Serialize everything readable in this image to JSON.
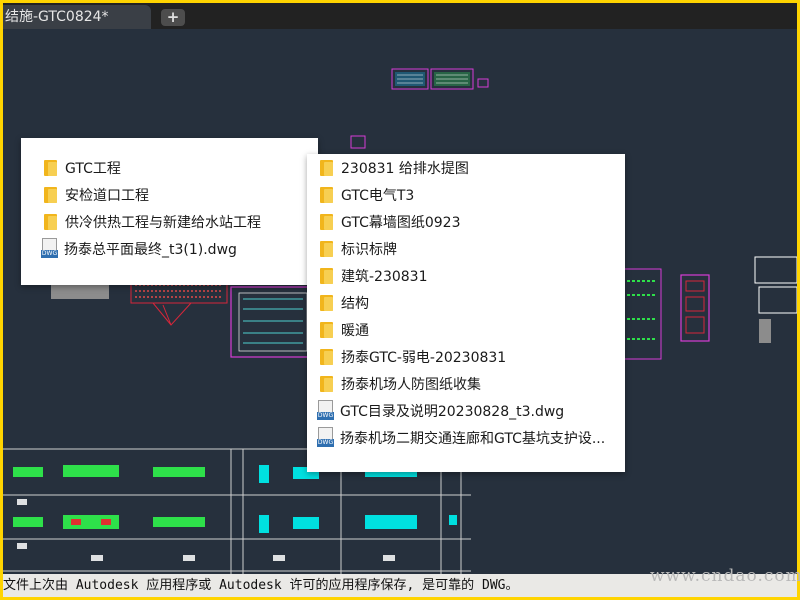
{
  "document_tab": {
    "title": "结施-GTC0824*"
  },
  "new_tab_button": {
    "label": "+"
  },
  "menu_left": {
    "items": [
      {
        "type": "folder",
        "label": "GTC工程"
      },
      {
        "type": "folder",
        "label": "安检道口工程"
      },
      {
        "type": "folder",
        "label": "供冷供热工程与新建给水站工程"
      },
      {
        "type": "dwg",
        "label": "扬泰总平面最终_t3(1).dwg"
      }
    ]
  },
  "menu_right": {
    "items": [
      {
        "type": "folder",
        "label": "230831 给排水提图"
      },
      {
        "type": "folder",
        "label": "GTC电气T3"
      },
      {
        "type": "folder",
        "label": "GTC幕墙图纸0923"
      },
      {
        "type": "folder",
        "label": "标识标牌"
      },
      {
        "type": "folder",
        "label": "建筑-230831"
      },
      {
        "type": "folder",
        "label": "结构"
      },
      {
        "type": "folder",
        "label": "暖通"
      },
      {
        "type": "folder",
        "label": "扬泰GTC-弱电-20230831"
      },
      {
        "type": "folder",
        "label": "扬泰机场人防图纸收集"
      },
      {
        "type": "dwg",
        "label": "GTC目录及说明20230828_t3.dwg"
      },
      {
        "type": "dwg",
        "label": "扬泰机场二期交通连廊和GTC基坑支护设..."
      }
    ]
  },
  "status_bar": {
    "text": "文件上次由 Autodesk 应用程序或 Autodesk 许可的应用程序保存, 是可靠的 DWG。"
  },
  "watermark": {
    "text": "www.cndao.com"
  },
  "colors": {
    "canvas": "#26303d",
    "frame": "#ffd400",
    "folder": "#f1b51c",
    "magenta": "#d63cd6",
    "cyan": "#00e0e0",
    "green": "#2ee04a"
  }
}
